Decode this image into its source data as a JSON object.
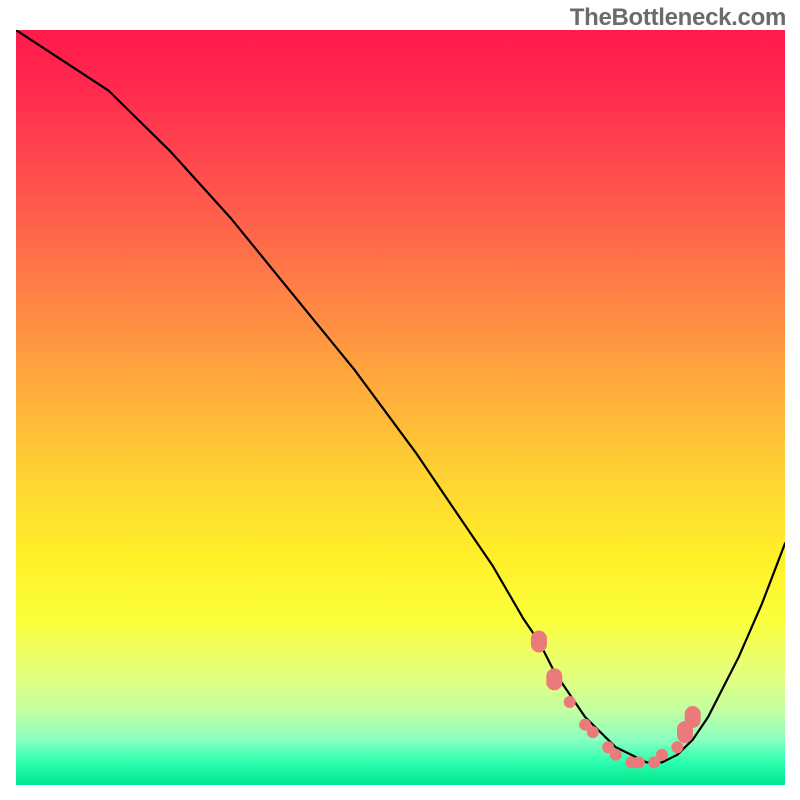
{
  "attribution": "TheBottleneck.com",
  "colors": {
    "gradient_top": "#ff1a4b",
    "gradient_mid": "#fff028",
    "gradient_bottom": "#00e58c",
    "curve": "#000000",
    "markers": "#ed7a7a"
  },
  "chart_data": {
    "type": "line",
    "title": "",
    "xlabel": "",
    "ylabel": "",
    "xlim": [
      0,
      100
    ],
    "ylim": [
      0,
      100
    ],
    "curve": {
      "x": [
        0,
        6,
        12,
        20,
        28,
        36,
        44,
        52,
        58,
        62,
        66,
        68,
        70,
        72,
        74,
        76,
        78,
        80,
        82,
        84,
        86,
        88,
        90,
        94,
        97,
        100
      ],
      "y": [
        100,
        96,
        92,
        84,
        75,
        65,
        55,
        44,
        35,
        29,
        22,
        19,
        15,
        12,
        9,
        7,
        5,
        4,
        3,
        3,
        4,
        6,
        9,
        17,
        24,
        32
      ]
    },
    "markers": {
      "x": [
        68,
        70,
        72,
        74,
        75,
        77,
        78,
        80,
        81,
        83,
        84,
        86,
        87,
        88
      ],
      "y": [
        19,
        14,
        11,
        8,
        7,
        5,
        4,
        3,
        3,
        3,
        4,
        5,
        7,
        9
      ]
    }
  }
}
